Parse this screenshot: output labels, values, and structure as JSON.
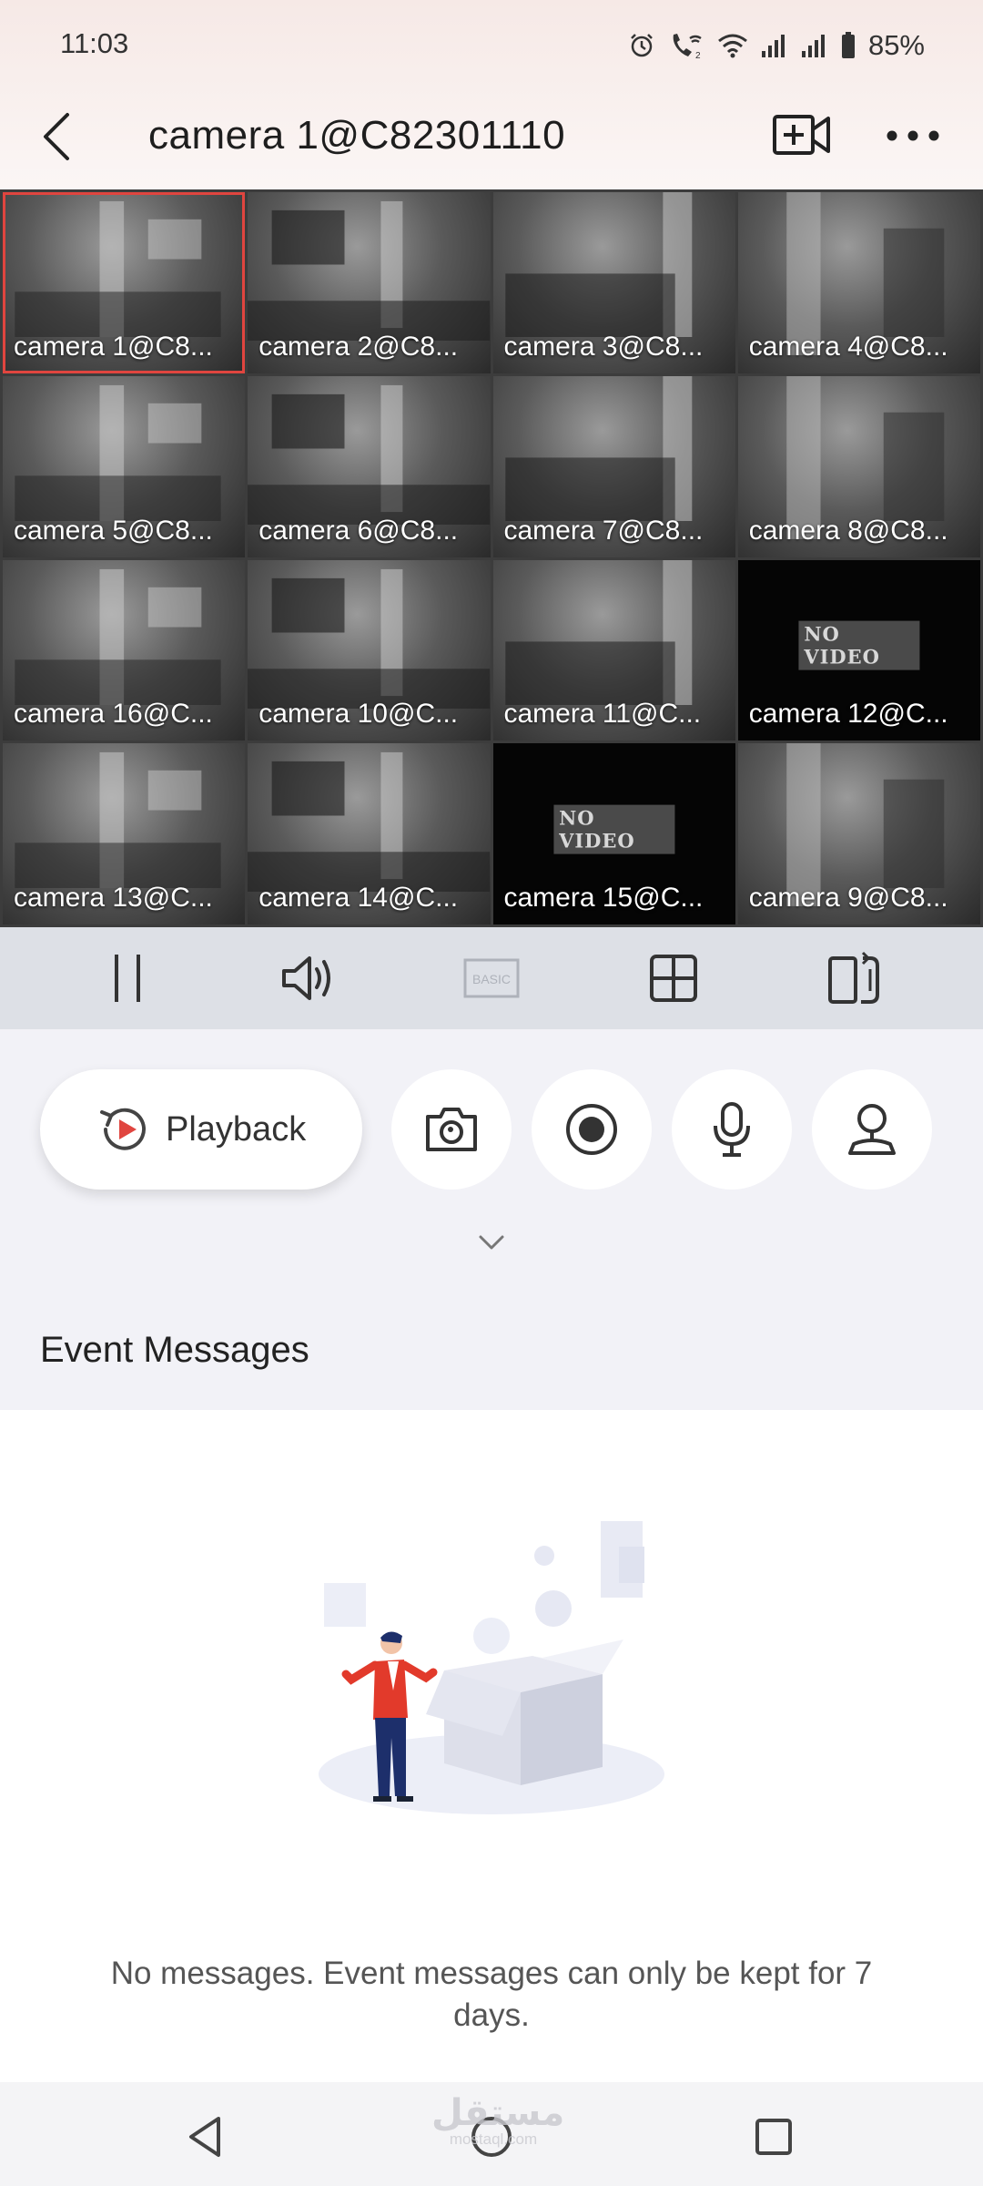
{
  "status_bar": {
    "time": "11:03",
    "battery": "85%",
    "icons": [
      "alarm-icon",
      "wifi-calling-icon",
      "wifi-icon",
      "signal-icon",
      "signal-icon",
      "battery-icon"
    ]
  },
  "header": {
    "title": "camera 1@C82301110",
    "back_icon": "back-chevron-icon",
    "add_icon": "add-camera-icon",
    "more_icon": "more-dots-icon"
  },
  "cameras": [
    {
      "label": "camera 1@C8...",
      "status": "live",
      "selected": true
    },
    {
      "label": "camera 2@C8...",
      "status": "live"
    },
    {
      "label": "camera 3@C8...",
      "status": "live"
    },
    {
      "label": "camera 4@C8...",
      "status": "live"
    },
    {
      "label": "camera 5@C8...",
      "status": "live"
    },
    {
      "label": "camera 6@C8...",
      "status": "live"
    },
    {
      "label": "camera 7@C8...",
      "status": "live"
    },
    {
      "label": "camera 8@C8...",
      "status": "live"
    },
    {
      "label": "camera 16@C...",
      "status": "live"
    },
    {
      "label": "camera 10@C...",
      "status": "live"
    },
    {
      "label": "camera 11@C...",
      "status": "live"
    },
    {
      "label": "camera 12@C...",
      "status": "no_video",
      "overlay": "NO VIDEO"
    },
    {
      "label": "camera 13@C...",
      "status": "live"
    },
    {
      "label": "camera 14@C...",
      "status": "live"
    },
    {
      "label": "camera 15@C...",
      "status": "no_video",
      "overlay": "NO VIDEO"
    },
    {
      "label": "camera 9@C8...",
      "status": "live"
    }
  ],
  "toolbar": {
    "pause_icon": "pause-icon",
    "volume_icon": "volume-icon",
    "quality_label": "BASIC",
    "layout_icon": "grid-layout-icon",
    "fullscreen_icon": "rotate-screen-icon"
  },
  "actions": {
    "playback_label": "Playback",
    "snapshot_icon": "camera-icon",
    "record_icon": "record-icon",
    "talk_icon": "microphone-icon",
    "ptz_icon": "ptz-icon"
  },
  "events": {
    "title": "Event Messages",
    "empty_text": "No messages. Event messages can only be kept for 7 days."
  },
  "nav": {
    "back_icon": "nav-back-icon",
    "home_icon": "nav-home-icon",
    "recents_icon": "nav-recents-icon"
  },
  "watermark": {
    "arabic": "مستقل",
    "latin": "mostaql.com"
  },
  "colors": {
    "accent": "#e0453f",
    "toolbar_bg": "#dde0e6",
    "page_bg": "#f2f2f7"
  }
}
